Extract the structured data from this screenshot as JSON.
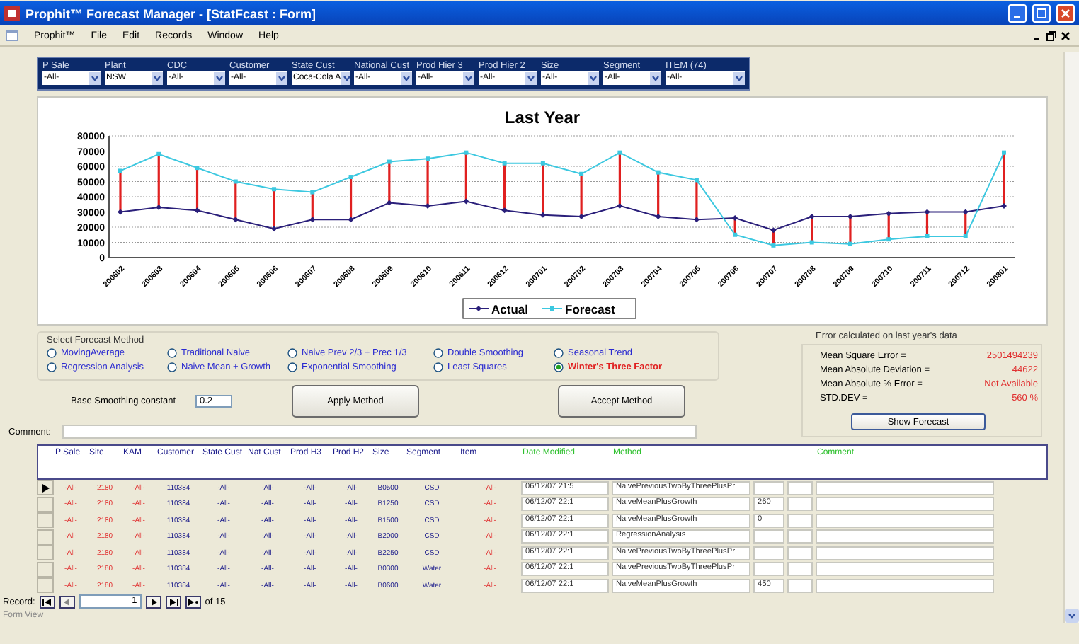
{
  "window": {
    "title": "Prophit™ Forecast Manager - [StatFcast : Form]"
  },
  "menu": [
    "Prophit™",
    "File",
    "Edit",
    "Records",
    "Window",
    "Help"
  ],
  "filters": [
    {
      "label": "P Sale",
      "value": "-All-"
    },
    {
      "label": "Plant",
      "value": "NSW"
    },
    {
      "label": "CDC",
      "value": "-All-"
    },
    {
      "label": "Customer",
      "value": "-All-"
    },
    {
      "label": "State Cust",
      "value": "Coca-Cola A"
    },
    {
      "label": "National Cust",
      "value": "-All-"
    },
    {
      "label": "Prod Hier 3",
      "value": "-All-"
    },
    {
      "label": "Prod Hier 2",
      "value": "-All-"
    },
    {
      "label": "Size",
      "value": "-All-"
    },
    {
      "label": "Segment",
      "value": "-All-"
    },
    {
      "label": "ITEM (74)",
      "value": "-All-"
    }
  ],
  "chart": {
    "chart_data": {
      "type": "line",
      "title": "Last Year",
      "categories": [
        "200602",
        "200603",
        "200604",
        "200605",
        "200606",
        "200607",
        "200608",
        "200609",
        "200610",
        "200611",
        "200612",
        "200701",
        "200702",
        "200703",
        "200704",
        "200705",
        "200706",
        "200707",
        "200708",
        "200709",
        "200710",
        "200711",
        "200712",
        "200801"
      ],
      "grid": true,
      "legend": true,
      "series": [
        {
          "name": "Actual",
          "color": "#2a1f7a",
          "marker": "diamond",
          "values": [
            30000,
            33000,
            31000,
            25000,
            19000,
            25000,
            25000,
            36000,
            34000,
            37000,
            31000,
            28000,
            27000,
            34000,
            27000,
            25000,
            26000,
            18000,
            27000,
            27000,
            29000,
            30000,
            30000,
            34000
          ]
        },
        {
          "name": "Forecast",
          "color": "#3cc8e0",
          "marker": "square",
          "values": [
            57000,
            68000,
            59000,
            50000,
            45000,
            43000,
            53000,
            63000,
            65000,
            69000,
            62000,
            62000,
            55000,
            69000,
            56000,
            51000,
            15000,
            8000,
            10000,
            9000,
            12000,
            14000,
            14000,
            69000
          ]
        }
      ],
      "ylim": [
        0,
        80000
      ],
      "yticks": [
        0,
        10000,
        20000,
        30000,
        40000,
        50000,
        60000,
        70000,
        80000
      ]
    }
  },
  "method_group": {
    "title": "Select Forecast Method",
    "options": [
      {
        "label": "MovingAverage",
        "selected": false
      },
      {
        "label": "Regression Analysis",
        "selected": false
      },
      {
        "label": "Traditional Naive",
        "selected": false
      },
      {
        "label": "Naive Mean + Growth",
        "selected": false
      },
      {
        "label": "Naive Prev 2/3 + Prec 1/3",
        "selected": false
      },
      {
        "label": "Exponential Smoothing",
        "selected": false
      },
      {
        "label": "Double Smoothing",
        "selected": false
      },
      {
        "label": "Least Squares",
        "selected": false
      },
      {
        "label": "Seasonal Trend",
        "selected": false
      },
      {
        "label": "Winter's Three Factor",
        "selected": true
      }
    ]
  },
  "smoothing": {
    "label": "Base Smoothing constant",
    "value": "0.2"
  },
  "buttons": [
    "Apply Method",
    "Accept Method"
  ],
  "comment": {
    "label": "Comment:"
  },
  "error_panel": {
    "title": "Error calculated on last year's data",
    "rows": [
      {
        "label": "Mean Square Error =",
        "value": "2501494239"
      },
      {
        "label": "Mean Absolute Deviation =",
        "value": "44622"
      },
      {
        "label": "Mean Absolute % Error =",
        "value": "Not Available"
      },
      {
        "label": "STD.DEV =",
        "value": "560 %"
      }
    ],
    "button": "Show Forecast"
  },
  "table": {
    "columns": [
      {
        "label": "P Sale",
        "kind": "key"
      },
      {
        "label": "Site",
        "kind": "key"
      },
      {
        "label": "KAM",
        "kind": "key"
      },
      {
        "label": "Customer",
        "kind": "attr"
      },
      {
        "label": "State Cust",
        "kind": "attr"
      },
      {
        "label": "Nat Cust",
        "kind": "attr"
      },
      {
        "label": "Prod H3",
        "kind": "attr"
      },
      {
        "label": "Prod H2",
        "kind": "attr"
      },
      {
        "label": "Size",
        "kind": "attr"
      },
      {
        "label": "Segment",
        "kind": "attr"
      },
      {
        "label": "Item",
        "kind": "key"
      },
      {
        "label": "Date Modified",
        "kind": "audit"
      },
      {
        "label": "Method",
        "kind": "audit"
      },
      {
        "label": "Comment",
        "kind": "audit"
      }
    ],
    "rows": [
      {
        "selected": true,
        "values": [
          "-All-",
          "2180",
          "-All-",
          "110384",
          "-All-",
          "-All-",
          "-All-",
          "-All-",
          "B0500",
          "CSD",
          "-All-"
        ],
        "date_modified": "06/12/07 21:5",
        "method": "NaivePreviousTwoByThreePlusPr"
      },
      {
        "selected": false,
        "values": [
          "-All-",
          "2180",
          "-All-",
          "110384",
          "-All-",
          "-All-",
          "-All-",
          "-All-",
          "B1250",
          "CSD",
          "-All-"
        ],
        "date_modified": "06/12/07 22:1",
        "method": "NaiveMeanPlusGrowth",
        "column_14": "260"
      },
      {
        "selected": false,
        "values": [
          "-All-",
          "2180",
          "-All-",
          "110384",
          "-All-",
          "-All-",
          "-All-",
          "-All-",
          "B1500",
          "CSD",
          "-All-"
        ],
        "date_modified": "06/12/07 22:1",
        "method": "NaiveMeanPlusGrowth",
        "column_14": "0"
      },
      {
        "selected": false,
        "values": [
          "-All-",
          "2180",
          "-All-",
          "110384",
          "-All-",
          "-All-",
          "-All-",
          "-All-",
          "B2000",
          "CSD",
          "-All-"
        ],
        "date_modified": "06/12/07 22:1",
        "method": "RegressionAnalysis"
      },
      {
        "selected": false,
        "values": [
          "-All-",
          "2180",
          "-All-",
          "110384",
          "-All-",
          "-All-",
          "-All-",
          "-All-",
          "B2250",
          "CSD",
          "-All-"
        ],
        "date_modified": "06/12/07 22:1",
        "method": "NaivePreviousTwoByThreePlusPr"
      },
      {
        "selected": false,
        "values": [
          "-All-",
          "2180",
          "-All-",
          "110384",
          "-All-",
          "-All-",
          "-All-",
          "-All-",
          "B0300",
          "Water",
          "-All-"
        ],
        "date_modified": "06/12/07 22:1",
        "method": "NaivePreviousTwoByThreePlusPr"
      },
      {
        "selected": false,
        "values": [
          "-All-",
          "2180",
          "-All-",
          "110384",
          "-All-",
          "-All-",
          "-All-",
          "-All-",
          "B0600",
          "Water",
          "-All-"
        ],
        "date_modified": "06/12/07 22:1",
        "method": "NaiveMeanPlusGrowth",
        "column_14": "450"
      }
    ]
  },
  "record_nav": {
    "label": "Record:",
    "current": "1",
    "total": "of 15"
  },
  "status_bar": "Form View"
}
